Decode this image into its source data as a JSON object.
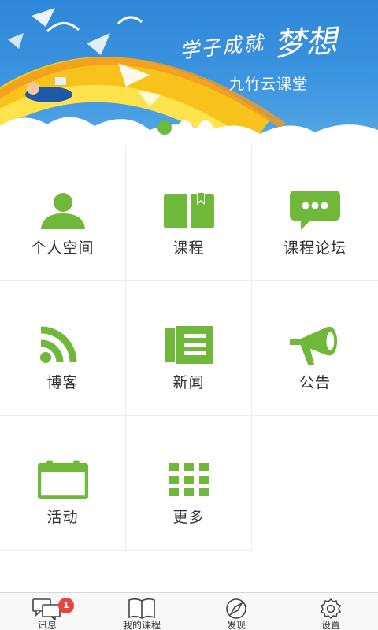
{
  "banner": {
    "slogan_small": "学子成就",
    "slogan_big": "梦想",
    "brand": "九竹云课堂",
    "carousel_dots": 3,
    "active_dot": 1
  },
  "grid": {
    "items": [
      {
        "label": "个人空间",
        "icon": "person-icon"
      },
      {
        "label": "课程",
        "icon": "book-icon"
      },
      {
        "label": "课程论坛",
        "icon": "chat-bubble-icon"
      },
      {
        "label": "博客",
        "icon": "rss-icon"
      },
      {
        "label": "新闻",
        "icon": "newspaper-icon"
      },
      {
        "label": "公告",
        "icon": "megaphone-icon"
      },
      {
        "label": "活动",
        "icon": "calendar-icon"
      },
      {
        "label": "更多",
        "icon": "grid-icon"
      }
    ]
  },
  "tabbar": {
    "tabs": [
      {
        "label": "讯息",
        "icon": "messages-icon",
        "badge": "1"
      },
      {
        "label": "我的课程",
        "icon": "open-book-icon"
      },
      {
        "label": "发现",
        "icon": "compass-icon"
      },
      {
        "label": "设置",
        "icon": "gear-icon"
      }
    ]
  },
  "colors": {
    "accent_green": "#6fb83a",
    "banner_blue": "#3c95e0",
    "badge_red": "#e8453c"
  }
}
